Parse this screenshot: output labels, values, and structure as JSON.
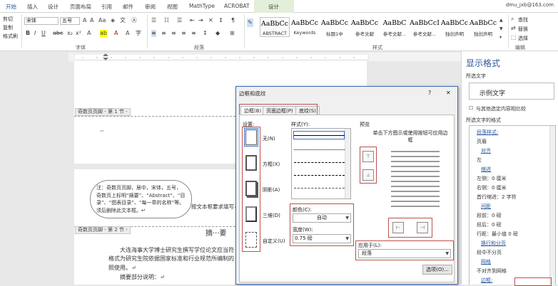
{
  "tabs": [
    "开始",
    "插入",
    "设计",
    "页面布局",
    "引用",
    "邮件",
    "审阅",
    "视图",
    "MathType",
    "ACROBAT",
    "设计"
  ],
  "user": "dmu_jxb@163.com",
  "ribbon": {
    "clipboard": {
      "cut": "剪切",
      "copy": "复制",
      "format_painter": "格式刷"
    },
    "font": {
      "name": "宋体",
      "size": "五号",
      "group_label": "字体"
    },
    "paragraph": {
      "group_label": "段落"
    },
    "styles": {
      "group_label": "样式",
      "items": [
        {
          "sample": "AaBbCc",
          "name": "ABSTRACT"
        },
        {
          "sample": "AaBbCc",
          "name": "Keywords"
        },
        {
          "sample": "AaBbCc",
          "name": "标题1中"
        },
        {
          "sample": "AaBbCc",
          "name": "参考文献"
        },
        {
          "sample": "AaBbC",
          "name": "参考文献..."
        },
        {
          "sample": "AaBbCcI",
          "name": "参考文献..."
        },
        {
          "sample": "AaBbCc",
          "name": "独创声明"
        },
        {
          "sample": "AaBbCc",
          "name": "独创声明"
        }
      ]
    },
    "editing": {
      "find": "查找",
      "replace": "替换",
      "select": "选择",
      "group_label": "编辑"
    }
  },
  "document": {
    "footer1": "奇数页页脚 - 第 1 节 -",
    "footer2": "奇数页页脚 - 第 2 节 -",
    "note": "注：奇数页页脚，居中，宋体，五号，奇数页上标明“摘要”、“Abstract”、“目录”、“图表目录”、“每一章的名称”等。须后删除此文本框。↵",
    "fill_hint": "按文本框要求填写↵",
    "heading": "摘···要",
    "body_line1": "大连海事大学博士研究生撰写学位论文应当符",
    "body_line2": "格式为研究生院依据国家标准和行业规范所编制的",
    "body_line3": "照使用。↵",
    "body_line4": "摘要部分说明：↵"
  },
  "pane": {
    "title": "显示格式",
    "selected_text_label": "所选文字",
    "sample": "示例文字",
    "compare_checkbox": "与其他选定内容相比较",
    "format_label": "所选文字的格式",
    "items": [
      {
        "text": "段落样式:",
        "link": true,
        "indent": 1
      },
      {
        "text": "页眉",
        "link": false,
        "indent": 1
      },
      {
        "text": "对齐",
        "link": true,
        "indent": 2
      },
      {
        "text": "左",
        "link": false,
        "indent": 1
      },
      {
        "text": "缩进",
        "link": true,
        "indent": 2
      },
      {
        "text": "左侧：0 厘米",
        "link": false,
        "indent": 1
      },
      {
        "text": "右侧：0 厘米",
        "link": false,
        "indent": 1
      },
      {
        "text": "首行缩进：2 字符",
        "link": false,
        "indent": 1
      },
      {
        "text": "间距",
        "link": true,
        "indent": 2
      },
      {
        "text": "段前：0 磅",
        "link": false,
        "indent": 1
      },
      {
        "text": "段后：0 磅",
        "link": false,
        "indent": 1
      },
      {
        "text": "行距：最小值 0 磅",
        "link": false,
        "indent": 1
      },
      {
        "text": "换行和分页",
        "link": true,
        "indent": 2
      },
      {
        "text": "段中不分页",
        "link": false,
        "indent": 1
      },
      {
        "text": "网格",
        "link": true,
        "indent": 2
      },
      {
        "text": "不对齐到网格",
        "link": false,
        "indent": 1
      },
      {
        "text": "边框:",
        "link": true,
        "indent": 2
      }
    ]
  },
  "dialog": {
    "title": "边框和底纹",
    "help": "?",
    "close": "✕",
    "tabs": [
      "边框(B)",
      "页面边框(P)",
      "底纹(S)"
    ],
    "setting_label": "设置:",
    "settings": [
      "无(N)",
      "方框(X)",
      "阴影(A)",
      "三维(D)",
      "自定义(U)"
    ],
    "style_label": "样式(Y):",
    "color_label": "颜色(C):",
    "color_value": "自动",
    "width_label": "宽度(W):",
    "width_value": "0.75 磅",
    "preview_label": "预览",
    "preview_hint": "单击下方图示或使用按钮可应用边框",
    "apply_label": "应用于(L):",
    "apply_value": "段落",
    "options_button": "选项(O)..."
  },
  "colors": {
    "accent": "#2b579a",
    "highlight": "#c0504d",
    "dialog_border": "#3c6ebf"
  }
}
